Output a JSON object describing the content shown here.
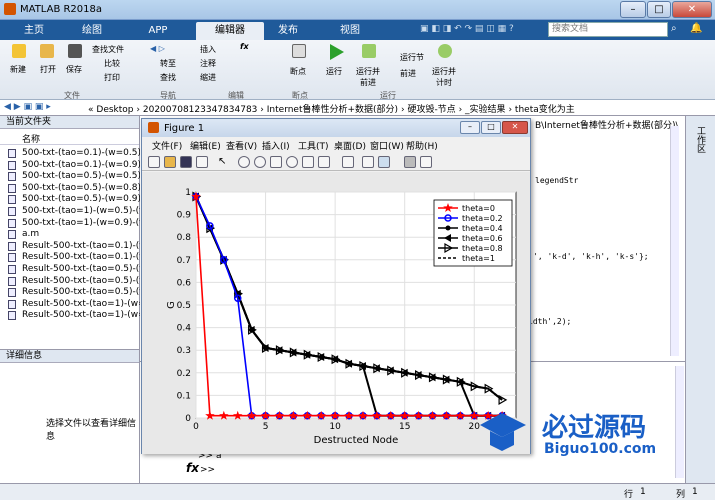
{
  "window": {
    "title": "MATLAB R2018a",
    "min": "–",
    "max": "□",
    "close": "✕"
  },
  "tabs": [
    "主页",
    "绘图",
    "APP",
    "编辑器",
    "发布",
    "视图"
  ],
  "search_placeholder": "搜索文档",
  "ribbon": {
    "new": "新建",
    "open": "打开",
    "save": "保存",
    "find_files": "查找文件",
    "compare": "比较",
    "print": "打印",
    "goto": "转至",
    "find": "查找",
    "insert": "插入",
    "fx": "fx",
    "comment": "注释",
    "indent": "缩进",
    "breakpoint": "断点",
    "run": "运行",
    "run_advance": "运行并\n前进",
    "run_section": "运行节",
    "advance": "前进",
    "run_time": "运行并\n计时",
    "group_file": "文件",
    "group_nav": "导航",
    "group_edit": "编辑",
    "group_bp": "断点",
    "group_run": "运行"
  },
  "address": {
    "items": [
      "«",
      "Desktop",
      "›",
      "20200708123347834783",
      "›",
      "Internet鲁棒性分析+数据(部分)",
      "›",
      "硬攻毁-节点",
      "›",
      "_实验结果",
      "›",
      "theta变化为主"
    ]
  },
  "file_panel": {
    "header": "当前文件夹",
    "col_name": "名称",
    "files": [
      "500-txt-(tao=0.1)-(w=0.5)-(t",
      "500-txt-(tao=0.1)-(w=0.9)-(t",
      "500-txt-(tao=0.5)-(w=0.5)-(t",
      "500-txt-(tao=0.5)-(w=0.8)-(t",
      "500-txt-(tao=0.5)-(w=0.9)-(t",
      "500-txt-(tao=1)-(w=0.5)-(the",
      "500-txt-(tao=1)-(w=0.9)-(the",
      "a.m",
      "Result-500-txt-(tao=0.1)-(w=",
      "Result-500-txt-(tao=0.1)-(w=",
      "Result-500-txt-(tao=0.5)-(w=",
      "Result-500-txt-(tao=0.5)-(w=",
      "Result-500-txt-(tao=0.5)-(w=",
      "Result-500-txt-(tao=1)-(w=0",
      "Result-500-txt-(tao=1)-(w=0"
    ]
  },
  "detail_panel": {
    "header": "详细信息",
    "empty_text": "选择文件以查看详细信息"
  },
  "editor_fragments": {
    "path": "B\\Internet鲁棒性分析+数据(部分)\\",
    "legend": "legendStr",
    "markers": "', 'k-d', 'k-h', 'k-s'};",
    "linewidth": "idth',2);"
  },
  "command_window": {
    "prompt1": ">> ",
    "prompt2": ">> a",
    "fx": "fx",
    "prompt3": ">>"
  },
  "status": {
    "row_label": "行",
    "row": "1",
    "col_label": "列",
    "col": "1"
  },
  "figure": {
    "title": "Figure 1",
    "menu": [
      "文件(F)",
      "编辑(E)",
      "查看(V)",
      "插入(I)",
      "工具(T)",
      "桌面(D)",
      "窗口(W)",
      "帮助(H)"
    ]
  },
  "watermark": {
    "cn": "必过源码",
    "en": "Biguo100.com"
  },
  "chart_data": {
    "type": "line",
    "xlabel": "Destructed Node",
    "ylabel": "G",
    "xlim": [
      0,
      23
    ],
    "ylim": [
      0,
      1
    ],
    "xticks": [
      0,
      5,
      10,
      15,
      20
    ],
    "yticks": [
      0,
      0.1,
      0.2,
      0.3,
      0.4,
      0.5,
      0.6,
      0.7,
      0.8,
      0.9,
      1
    ],
    "grid": true,
    "legend_position": "top-right",
    "series": [
      {
        "name": "theta=0",
        "color": "#ff0000",
        "marker": "star",
        "x": [
          0,
          1,
          2,
          3,
          4,
          5,
          6,
          7,
          8,
          9,
          10,
          11,
          12,
          13,
          14,
          15,
          16,
          17,
          18,
          19,
          20,
          21,
          22
        ],
        "y": [
          0.98,
          0.01,
          0.01,
          0.01,
          0.01,
          0.01,
          0.01,
          0.01,
          0.01,
          0.01,
          0.01,
          0.01,
          0.01,
          0.01,
          0.01,
          0.01,
          0.01,
          0.01,
          0.01,
          0.01,
          0.01,
          0.01,
          0.01
        ]
      },
      {
        "name": "theta=0.2",
        "color": "#0000ff",
        "marker": "circle",
        "x": [
          0,
          1,
          2,
          3,
          4,
          5,
          6,
          7,
          8,
          9,
          10,
          11,
          12,
          13,
          14,
          15,
          16,
          17,
          18,
          19,
          20,
          21,
          22
        ],
        "y": [
          0.98,
          0.85,
          0.7,
          0.53,
          0.01,
          0.01,
          0.01,
          0.01,
          0.01,
          0.01,
          0.01,
          0.01,
          0.01,
          0.01,
          0.01,
          0.01,
          0.01,
          0.01,
          0.01,
          0.01,
          0.01,
          0.01,
          0.01
        ]
      },
      {
        "name": "theta=0.4",
        "color": "#000000",
        "marker": "dot",
        "x": [
          0,
          1,
          2,
          3,
          4,
          5,
          6,
          7,
          8,
          9,
          10,
          11,
          12,
          13,
          14,
          15,
          16,
          17,
          18,
          19,
          20,
          21,
          22
        ],
        "y": [
          0.98,
          0.84,
          0.7,
          0.55,
          0.39,
          0.31,
          0.3,
          0.29,
          0.28,
          0.27,
          0.26,
          0.24,
          0.23,
          0.01,
          0.01,
          0.01,
          0.01,
          0.01,
          0.01,
          0.01,
          0.01,
          0.01,
          0.01
        ]
      },
      {
        "name": "theta=0.6",
        "color": "#000000",
        "marker": "triangle-left",
        "x": [
          0,
          1,
          2,
          3,
          4,
          5,
          6,
          7,
          8,
          9,
          10,
          11,
          12,
          13,
          14,
          15,
          16,
          17,
          18,
          19,
          20,
          21,
          22
        ],
        "y": [
          0.98,
          0.84,
          0.7,
          0.55,
          0.39,
          0.31,
          0.3,
          0.29,
          0.28,
          0.27,
          0.26,
          0.24,
          0.23,
          0.22,
          0.21,
          0.2,
          0.19,
          0.18,
          0.17,
          0.16,
          0.01,
          0.01,
          0.01
        ]
      },
      {
        "name": "theta=0.8",
        "color": "#000000",
        "marker": "triangle-right",
        "x": [
          0,
          1,
          2,
          3,
          4,
          5,
          6,
          7,
          8,
          9,
          10,
          11,
          12,
          13,
          14,
          15,
          16,
          17,
          18,
          19,
          20,
          21,
          22
        ],
        "y": [
          0.98,
          0.84,
          0.7,
          0.55,
          0.39,
          0.31,
          0.3,
          0.29,
          0.28,
          0.27,
          0.26,
          0.24,
          0.23,
          0.22,
          0.21,
          0.2,
          0.19,
          0.18,
          0.17,
          0.16,
          0.14,
          0.13,
          0.08
        ]
      },
      {
        "name": "theta=1",
        "color": "#000000",
        "marker": "none",
        "dash": true,
        "x": [
          0,
          1,
          2,
          3,
          4,
          5,
          6,
          7,
          8,
          9,
          10,
          11,
          12,
          13,
          14,
          15,
          16,
          17,
          18,
          19,
          20,
          21,
          22
        ],
        "y": [
          0.98,
          0.84,
          0.7,
          0.55,
          0.39,
          0.31,
          0.3,
          0.29,
          0.28,
          0.27,
          0.26,
          0.24,
          0.23,
          0.22,
          0.21,
          0.2,
          0.19,
          0.18,
          0.17,
          0.16,
          0.14,
          0.13,
          0.08
        ]
      }
    ]
  }
}
